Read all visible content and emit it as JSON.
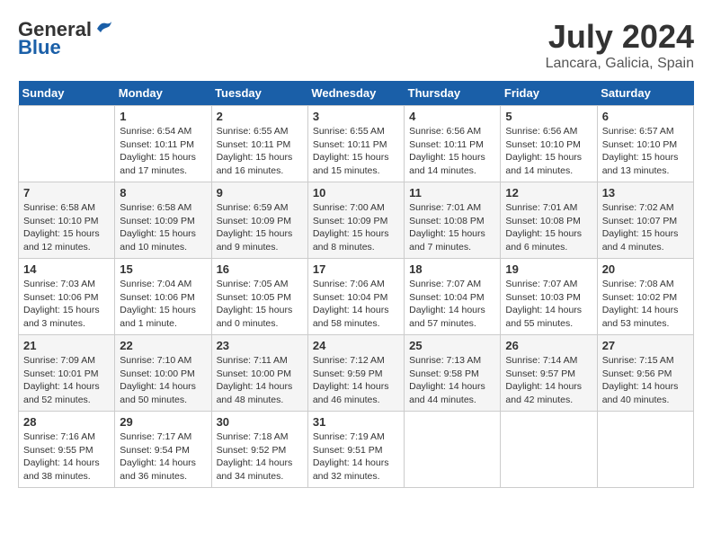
{
  "header": {
    "logo_general": "General",
    "logo_blue": "Blue",
    "title": "July 2024",
    "location": "Lancara, Galicia, Spain"
  },
  "calendar": {
    "days_of_week": [
      "Sunday",
      "Monday",
      "Tuesday",
      "Wednesday",
      "Thursday",
      "Friday",
      "Saturday"
    ],
    "weeks": [
      [
        {
          "day": "",
          "info": ""
        },
        {
          "day": "1",
          "info": "Sunrise: 6:54 AM\nSunset: 10:11 PM\nDaylight: 15 hours\nand 17 minutes."
        },
        {
          "day": "2",
          "info": "Sunrise: 6:55 AM\nSunset: 10:11 PM\nDaylight: 15 hours\nand 16 minutes."
        },
        {
          "day": "3",
          "info": "Sunrise: 6:55 AM\nSunset: 10:11 PM\nDaylight: 15 hours\nand 15 minutes."
        },
        {
          "day": "4",
          "info": "Sunrise: 6:56 AM\nSunset: 10:11 PM\nDaylight: 15 hours\nand 14 minutes."
        },
        {
          "day": "5",
          "info": "Sunrise: 6:56 AM\nSunset: 10:10 PM\nDaylight: 15 hours\nand 14 minutes."
        },
        {
          "day": "6",
          "info": "Sunrise: 6:57 AM\nSunset: 10:10 PM\nDaylight: 15 hours\nand 13 minutes."
        }
      ],
      [
        {
          "day": "7",
          "info": "Sunrise: 6:58 AM\nSunset: 10:10 PM\nDaylight: 15 hours\nand 12 minutes."
        },
        {
          "day": "8",
          "info": "Sunrise: 6:58 AM\nSunset: 10:09 PM\nDaylight: 15 hours\nand 10 minutes."
        },
        {
          "day": "9",
          "info": "Sunrise: 6:59 AM\nSunset: 10:09 PM\nDaylight: 15 hours\nand 9 minutes."
        },
        {
          "day": "10",
          "info": "Sunrise: 7:00 AM\nSunset: 10:09 PM\nDaylight: 15 hours\nand 8 minutes."
        },
        {
          "day": "11",
          "info": "Sunrise: 7:01 AM\nSunset: 10:08 PM\nDaylight: 15 hours\nand 7 minutes."
        },
        {
          "day": "12",
          "info": "Sunrise: 7:01 AM\nSunset: 10:08 PM\nDaylight: 15 hours\nand 6 minutes."
        },
        {
          "day": "13",
          "info": "Sunrise: 7:02 AM\nSunset: 10:07 PM\nDaylight: 15 hours\nand 4 minutes."
        }
      ],
      [
        {
          "day": "14",
          "info": "Sunrise: 7:03 AM\nSunset: 10:06 PM\nDaylight: 15 hours\nand 3 minutes."
        },
        {
          "day": "15",
          "info": "Sunrise: 7:04 AM\nSunset: 10:06 PM\nDaylight: 15 hours\nand 1 minute."
        },
        {
          "day": "16",
          "info": "Sunrise: 7:05 AM\nSunset: 10:05 PM\nDaylight: 15 hours\nand 0 minutes."
        },
        {
          "day": "17",
          "info": "Sunrise: 7:06 AM\nSunset: 10:04 PM\nDaylight: 14 hours\nand 58 minutes."
        },
        {
          "day": "18",
          "info": "Sunrise: 7:07 AM\nSunset: 10:04 PM\nDaylight: 14 hours\nand 57 minutes."
        },
        {
          "day": "19",
          "info": "Sunrise: 7:07 AM\nSunset: 10:03 PM\nDaylight: 14 hours\nand 55 minutes."
        },
        {
          "day": "20",
          "info": "Sunrise: 7:08 AM\nSunset: 10:02 PM\nDaylight: 14 hours\nand 53 minutes."
        }
      ],
      [
        {
          "day": "21",
          "info": "Sunrise: 7:09 AM\nSunset: 10:01 PM\nDaylight: 14 hours\nand 52 minutes."
        },
        {
          "day": "22",
          "info": "Sunrise: 7:10 AM\nSunset: 10:00 PM\nDaylight: 14 hours\nand 50 minutes."
        },
        {
          "day": "23",
          "info": "Sunrise: 7:11 AM\nSunset: 10:00 PM\nDaylight: 14 hours\nand 48 minutes."
        },
        {
          "day": "24",
          "info": "Sunrise: 7:12 AM\nSunset: 9:59 PM\nDaylight: 14 hours\nand 46 minutes."
        },
        {
          "day": "25",
          "info": "Sunrise: 7:13 AM\nSunset: 9:58 PM\nDaylight: 14 hours\nand 44 minutes."
        },
        {
          "day": "26",
          "info": "Sunrise: 7:14 AM\nSunset: 9:57 PM\nDaylight: 14 hours\nand 42 minutes."
        },
        {
          "day": "27",
          "info": "Sunrise: 7:15 AM\nSunset: 9:56 PM\nDaylight: 14 hours\nand 40 minutes."
        }
      ],
      [
        {
          "day": "28",
          "info": "Sunrise: 7:16 AM\nSunset: 9:55 PM\nDaylight: 14 hours\nand 38 minutes."
        },
        {
          "day": "29",
          "info": "Sunrise: 7:17 AM\nSunset: 9:54 PM\nDaylight: 14 hours\nand 36 minutes."
        },
        {
          "day": "30",
          "info": "Sunrise: 7:18 AM\nSunset: 9:52 PM\nDaylight: 14 hours\nand 34 minutes."
        },
        {
          "day": "31",
          "info": "Sunrise: 7:19 AM\nSunset: 9:51 PM\nDaylight: 14 hours\nand 32 minutes."
        },
        {
          "day": "",
          "info": ""
        },
        {
          "day": "",
          "info": ""
        },
        {
          "day": "",
          "info": ""
        }
      ]
    ]
  }
}
